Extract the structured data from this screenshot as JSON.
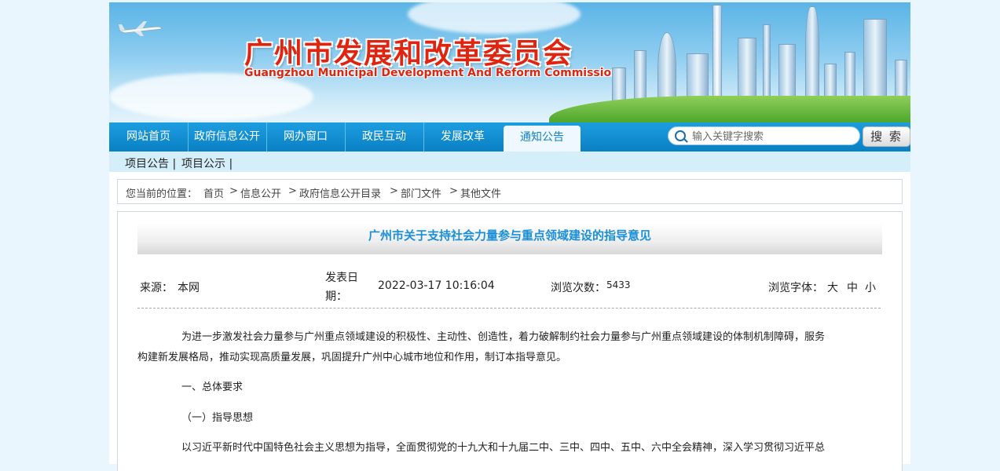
{
  "header": {
    "title_cn": "广州市发展和改革委员会",
    "title_en": "Guangzhou Municipal Development And Reform Commission"
  },
  "nav": {
    "items": [
      "网站首页",
      "政府信息公开",
      "网办窗口",
      "政民互动",
      "发展改革",
      "通知公告"
    ],
    "active": "通知公告"
  },
  "search": {
    "placeholder": "输入关键字搜索",
    "button": "搜 索"
  },
  "subnav": {
    "items": [
      "项目公告 |",
      "项目公示 |"
    ]
  },
  "breadcrumb": {
    "prefix": "您当前的位置：",
    "items": [
      "首页",
      ">",
      "信息公开",
      ">",
      "政府信息公开目录",
      ">",
      "部门文件",
      ">",
      "其他文件"
    ]
  },
  "article": {
    "title": "广州市关于支持社会力量参与重点领域建设的指导意见",
    "source_label": "来源：",
    "source": "本网",
    "date_label_1": "发表日",
    "date_label_2": "期：",
    "date": "2022-03-17 10:16:04",
    "views_label": "浏览次数：",
    "views": "5433",
    "font_label": "浏览字体：",
    "font_large": "大",
    "font_medium": "中",
    "font_small": "小",
    "para1_line1": "为进一步激发社会力量参与广州重点领域建设的积极性、主动性、创造性，着力破解制约社会力量参与广州重点领域建设的体制机制障碍，服务",
    "para1_line2": "构建新发展格局，推动实现高质量发展，巩固提升广州中心城市地位和作用，制订本指导意见。",
    "heading1": "一、总体要求",
    "heading2": "（一）指导思想",
    "para2_line1": "以习近平新时代中国特色社会主义思想为指导，全面贯彻党的十九大和十九届二中、三中、四中、五中、六中全会精神，深入学习贯彻习近平总"
  },
  "colors": {
    "nav": "#0a7fc4",
    "title_red": "#e02410",
    "article_title": "#1a8fd8"
  }
}
